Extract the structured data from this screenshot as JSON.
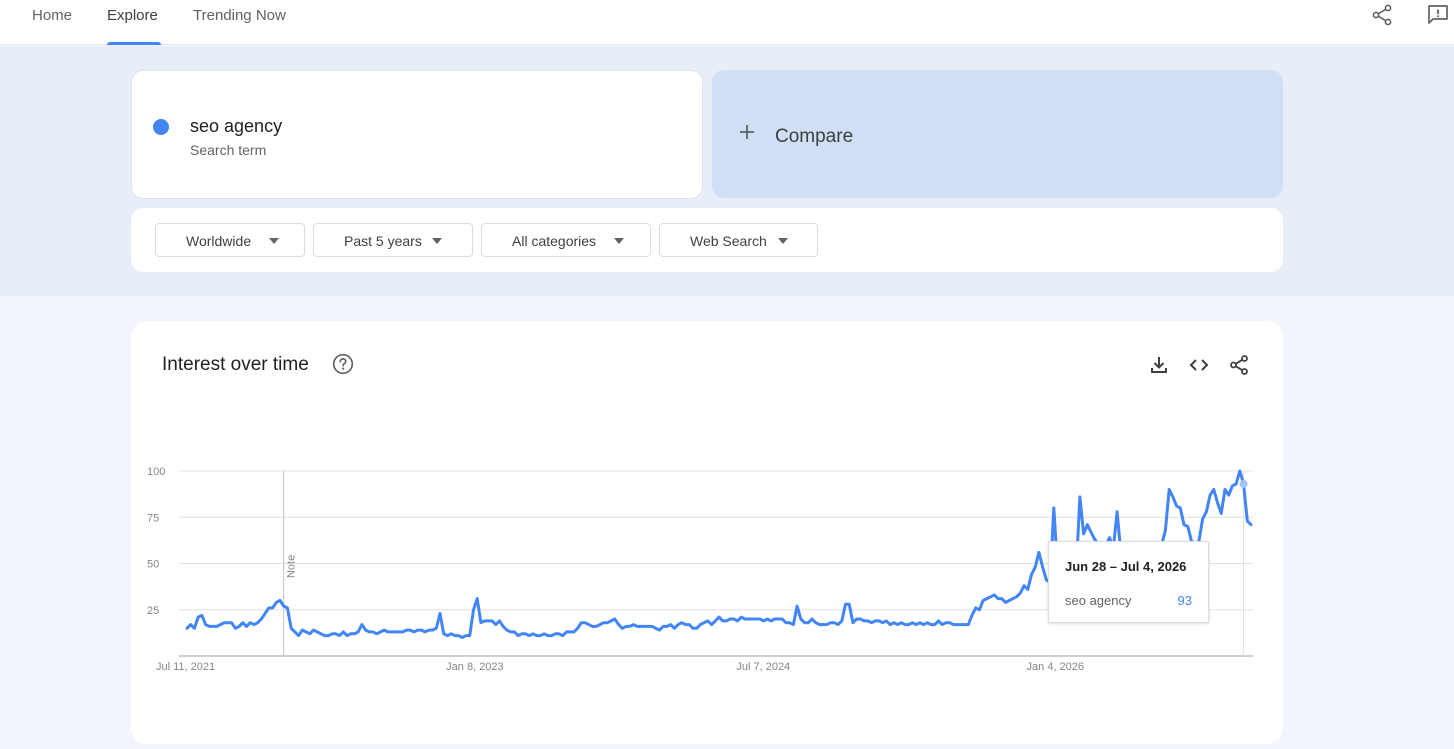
{
  "nav": {
    "tabs": [
      {
        "label": "Home"
      },
      {
        "label": "Explore"
      },
      {
        "label": "Trending Now"
      }
    ],
    "active_tab": "Explore",
    "icons": [
      "share-icon",
      "feedback-icon"
    ]
  },
  "search_term": {
    "name": "seo agency",
    "subtitle": "Search term",
    "color": "#4285f4"
  },
  "compare": {
    "label": "Compare"
  },
  "filters": {
    "region": "Worldwide",
    "time": "Past 5 years",
    "category": "All categories",
    "property": "Web Search"
  },
  "card": {
    "title": "Interest over time",
    "icons": [
      "help-icon",
      "download-icon",
      "embed-icon",
      "share-icon"
    ]
  },
  "tooltip": {
    "date": "Jun 28 – Jul 4, 2026",
    "term": "seo agency",
    "value": "93"
  },
  "chart_data": {
    "type": "line",
    "title": "",
    "xlabel": "",
    "ylabel": "",
    "ylim": [
      0,
      100
    ],
    "yticks": [
      "100",
      "75",
      "50",
      "25"
    ],
    "xticks": [
      "Jul 11, 2021",
      "Jan 8, 2023",
      "Jul 7, 2024",
      "Jan 4, 2026"
    ],
    "note_label": "Note",
    "note_at_week": 26,
    "grid": true,
    "x_start": "2021-07-11",
    "x_unit": "week",
    "series": [
      {
        "name": "seo agency",
        "color": "#4285f4",
        "values": [
          15,
          17,
          15,
          21,
          22,
          17,
          16,
          16,
          16,
          17,
          18,
          18,
          18,
          15,
          16,
          18,
          16,
          18,
          17,
          18,
          20,
          23,
          26,
          26,
          29,
          30,
          27,
          26,
          15,
          13,
          11,
          14,
          13,
          12,
          14,
          13,
          12,
          11,
          11,
          12,
          12,
          11,
          13,
          11,
          12,
          12,
          13,
          17,
          14,
          13,
          13,
          12,
          13,
          14,
          13,
          13,
          13,
          13,
          13,
          14,
          14,
          13,
          14,
          14,
          13,
          14,
          14,
          15,
          23,
          12,
          11,
          12,
          11,
          11,
          10,
          11,
          11,
          25,
          31,
          18,
          19,
          19,
          19,
          17,
          19,
          16,
          14,
          13,
          13,
          11,
          12,
          12,
          11,
          12,
          11,
          11,
          12,
          11,
          11,
          12,
          12,
          11,
          13,
          13,
          13,
          15,
          18,
          18,
          17,
          16,
          16,
          17,
          18,
          18,
          19,
          20,
          17,
          15,
          16,
          16,
          17,
          16,
          16,
          16,
          16,
          16,
          15,
          14,
          16,
          16,
          17,
          15,
          17,
          18,
          17,
          17,
          15,
          15,
          17,
          18,
          19,
          17,
          19,
          21,
          19,
          19,
          20,
          20,
          19,
          21,
          20,
          20,
          20,
          20,
          20,
          19,
          20,
          19,
          20,
          20,
          20,
          18,
          18,
          17,
          27,
          20,
          18,
          18,
          20,
          18,
          17,
          17,
          17,
          18,
          18,
          17,
          19,
          28,
          28,
          18,
          20,
          20,
          19,
          19,
          18,
          19,
          19,
          18,
          19,
          17,
          18,
          17,
          18,
          17,
          17,
          18,
          17,
          18,
          17,
          18,
          17,
          17,
          19,
          17,
          18,
          18,
          17,
          17,
          17,
          17,
          17,
          22,
          26,
          25,
          30,
          31,
          32,
          33,
          31,
          31,
          29,
          30,
          31,
          32,
          34,
          38,
          36,
          44,
          48,
          56,
          48,
          41,
          40,
          80,
          48,
          43,
          42,
          47,
          46,
          45,
          86,
          66,
          71,
          67,
          63,
          60,
          61,
          60,
          64,
          58,
          78,
          56,
          50,
          45,
          42,
          40,
          40,
          40,
          41,
          38,
          37,
          35,
          60,
          68,
          90,
          86,
          81,
          80,
          71,
          70,
          62,
          61,
          62,
          74,
          78,
          87,
          90,
          83,
          77,
          90,
          87,
          92,
          93,
          100,
          93,
          73,
          71
        ]
      }
    ]
  }
}
